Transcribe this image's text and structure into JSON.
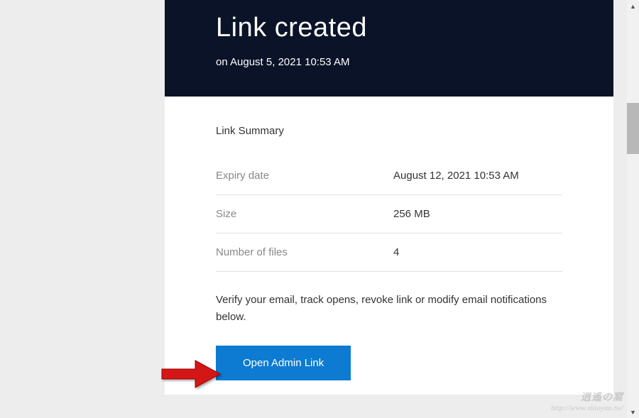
{
  "header": {
    "title": "Link created",
    "subtitle": "on August 5, 2021 10:53 AM"
  },
  "summary": {
    "title": "Link Summary",
    "rows": [
      {
        "label": "Expiry date",
        "value": "August 12, 2021 10:53 AM"
      },
      {
        "label": "Size",
        "value": "256 MB"
      },
      {
        "label": "Number of files",
        "value": "4"
      }
    ]
  },
  "verify_text": "Verify your email, track opens, revoke link or modify email notifications below.",
  "button": {
    "label": "Open Admin Link"
  },
  "watermark": {
    "title": "逍遙の窩",
    "url": "http://www.xiaoyao.tw/"
  }
}
